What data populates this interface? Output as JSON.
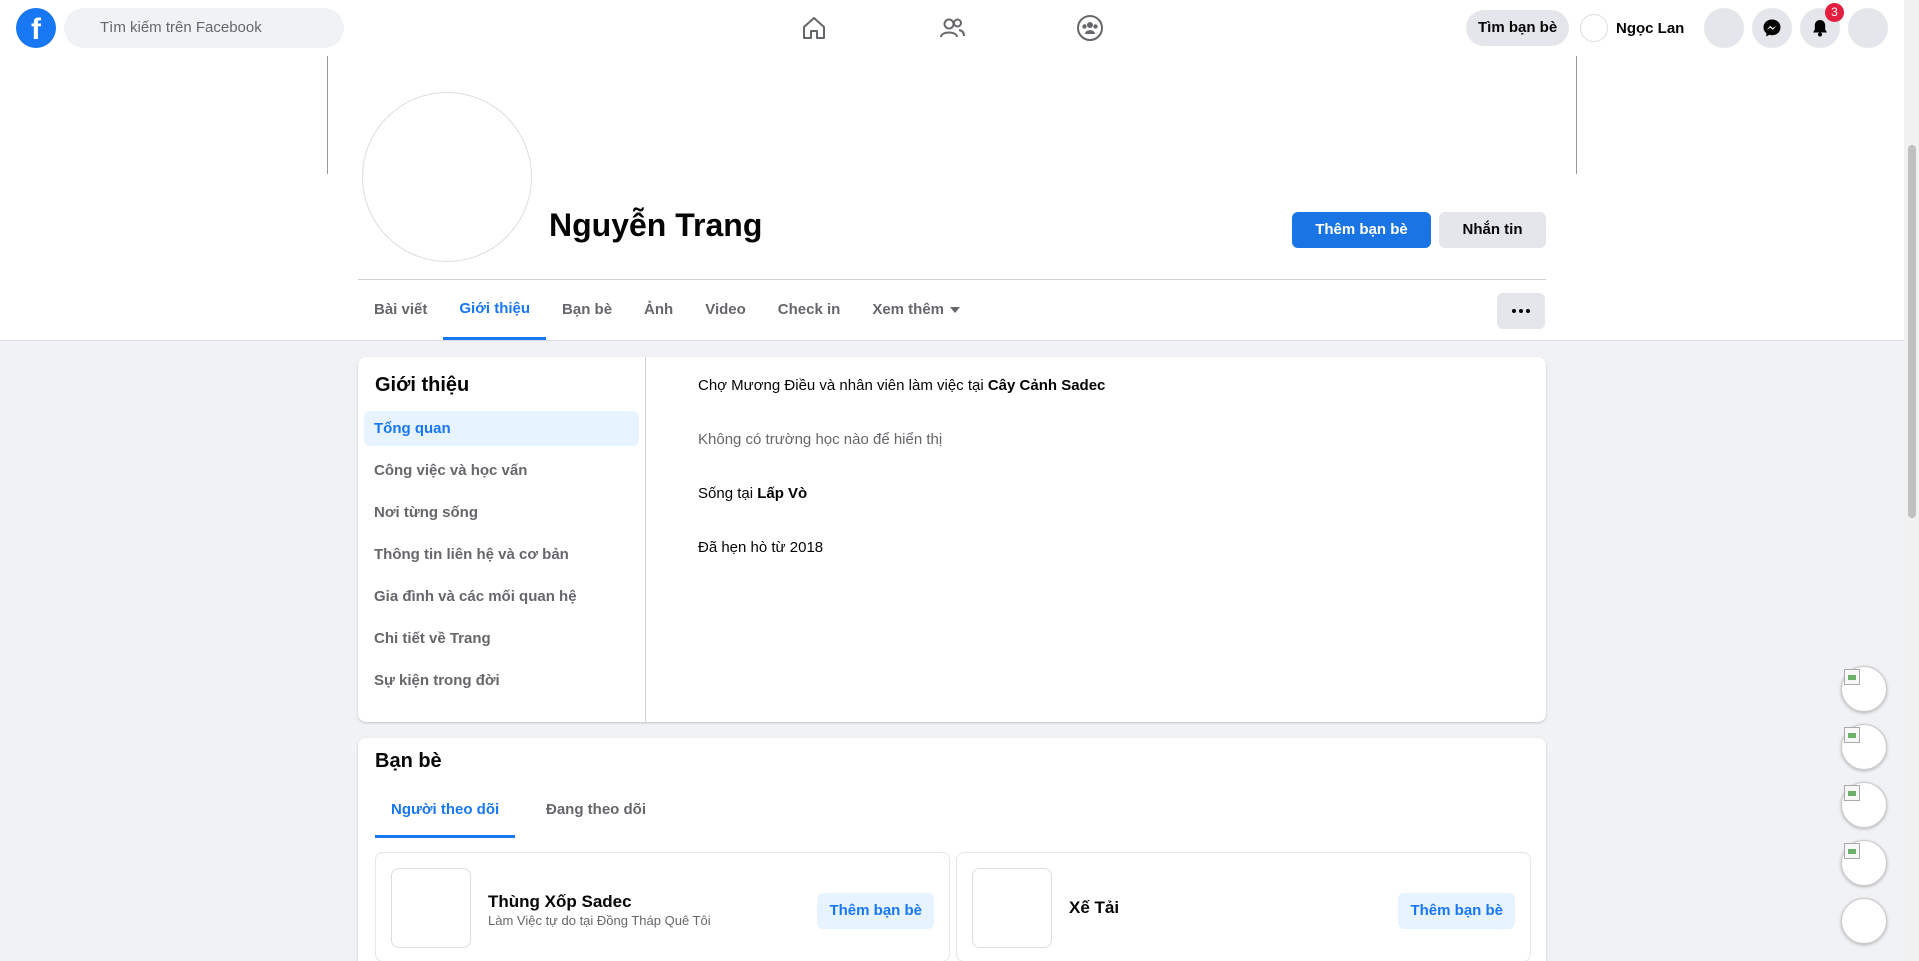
{
  "topbar": {
    "search_placeholder": "Tìm kiếm trên Facebook",
    "find_friends_label": "Tìm bạn bè",
    "user_name": "Ngọc Lan",
    "notifications_count": "3",
    "logo_letter": "f",
    "brand_color": "#1877f2"
  },
  "profile": {
    "name": "Nguyễn Trang",
    "add_friend_label": "Thêm bạn bè",
    "message_label": "Nhắn tin"
  },
  "tabs": [
    {
      "label": "Bài viết"
    },
    {
      "label": "Giới thiệu",
      "active": true
    },
    {
      "label": "Bạn bè"
    },
    {
      "label": "Ảnh"
    },
    {
      "label": "Video"
    },
    {
      "label": "Check in"
    },
    {
      "label": "Xem thêm"
    }
  ],
  "about": {
    "title": "Giới thiệu",
    "nav": [
      "Tổng quan",
      "Công việc và học vấn",
      "Nơi từng sống",
      "Thông tin liên hệ và cơ bản",
      "Gia đình và các mối quan hệ",
      "Chi tiết về Trang",
      "Sự kiện trong đời"
    ],
    "work_prefix": "Chợ Mương Điều và nhân viên làm việc tại ",
    "work_place": "Cây Cảnh Sadec",
    "education": "Không có trường học nào để hiển thị",
    "lives_prefix": "Sống tại ",
    "lives_place": "Lấp Vò",
    "relationship": "Đã hẹn hò từ 2018"
  },
  "friends": {
    "title": "Bạn bè",
    "tabs": [
      "Người theo dõi",
      "Đang theo dõi"
    ],
    "items": [
      {
        "name": "Thùng Xốp Sadec",
        "subtitle": "Làm Việc tự do tại Đồng Tháp Quê Tôi",
        "button": "Thêm bạn bè"
      },
      {
        "name": "Xế Tải",
        "subtitle": "",
        "button": "Thêm bạn bè"
      }
    ]
  },
  "icons": {
    "home": "home-icon",
    "friends": "friends-icon",
    "groups": "groups-icon",
    "messenger": "messenger-icon",
    "notifications": "bell-icon"
  }
}
